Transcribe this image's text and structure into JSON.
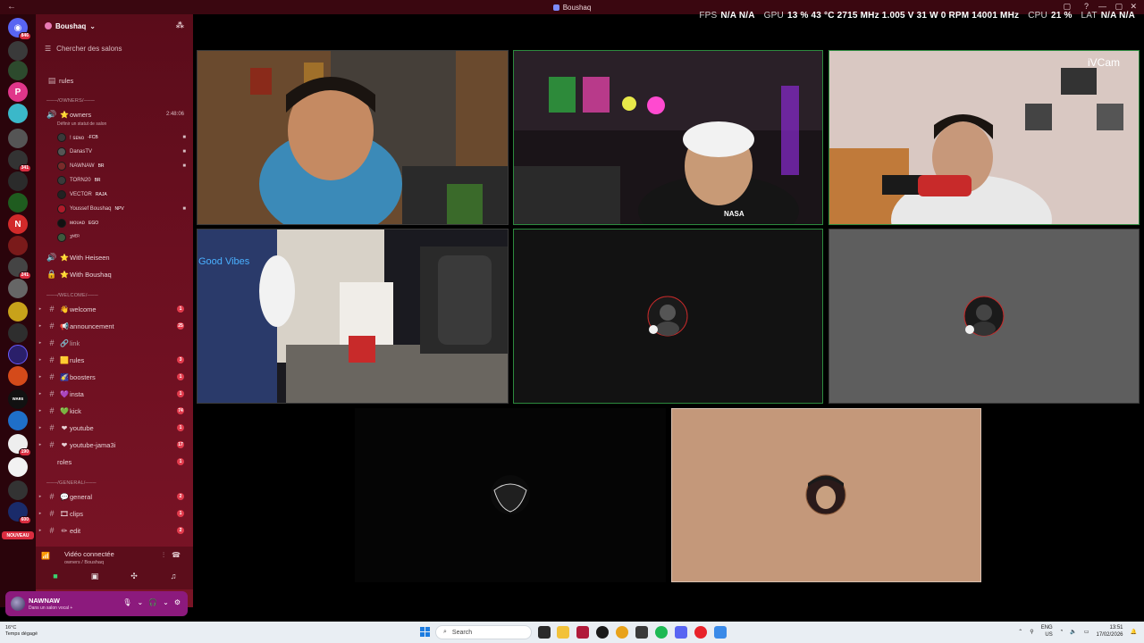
{
  "titlebar": {
    "title": "Boushaq"
  },
  "perf": [
    {
      "key": "FPS",
      "value": "N/A  N/A"
    },
    {
      "key": "GPU",
      "value": "13 %  43 °C  2715 MHz  1.005 V  31 W  0 RPM  14001 MHz"
    },
    {
      "key": "CPU",
      "value": "21 %"
    },
    {
      "key": "LAT",
      "value": "N/A  N/A"
    }
  ],
  "server": {
    "name": "Boushaq",
    "search_placeholder": "Chercher des salons"
  },
  "rail_badges": [
    "846",
    "341",
    "241",
    "190",
    "600"
  ],
  "rail_new_label": "NOUVEAU",
  "channels_top": [
    {
      "label": "rules"
    }
  ],
  "owners_category": "───/OWNERS/───",
  "owners_channel": {
    "label": "owners",
    "timer": "2:48:06",
    "status_hint": "Définir un statut de salon"
  },
  "members": [
    {
      "name": "! ꜱᴇɴᴏ",
      "tag": "-FCB",
      "cam": true
    },
    {
      "name": "DanasTV",
      "tag": "",
      "cam": true
    },
    {
      "name": "NAWNAW",
      "tag": "BR",
      "cam": true
    },
    {
      "name": "TORN20",
      "tag": "BR",
      "cam": false
    },
    {
      "name": "VECTOR",
      "tag": "RAJA",
      "cam": false
    },
    {
      "name": "Youssef Boushaq",
      "tag": "NPV",
      "cam": true
    },
    {
      "name": "ᴍᴏᴜᴀᴅ",
      "tag": "EGO",
      "cam": false
    },
    {
      "name": "ᴣᴹᴱᴿ",
      "tag": "",
      "cam": false
    }
  ],
  "voice_channels": [
    {
      "label": "With Heiseen"
    },
    {
      "label": "With Boushaq"
    }
  ],
  "welcome_category": "───/WELCOME/───",
  "text_channels": [
    {
      "label": "welcome",
      "emoji": "👋",
      "count": "1"
    },
    {
      "label": "announcement",
      "emoji": "📢",
      "count": "25"
    },
    {
      "label": "link",
      "emoji": "🔗",
      "count": ""
    },
    {
      "label": "rules",
      "emoji": "🟨",
      "count": "3"
    },
    {
      "label": "boosters",
      "emoji": "🌠",
      "count": "1"
    },
    {
      "label": "insta",
      "emoji": "💜",
      "count": "1"
    },
    {
      "label": "kick",
      "emoji": "💚",
      "count": "74"
    },
    {
      "label": "youtube",
      "emoji": "❤",
      "count": "1"
    },
    {
      "label": "youtube-jama3i",
      "emoji": "❤",
      "count": "17"
    },
    {
      "label": "roles",
      "emoji": "",
      "count": "1"
    }
  ],
  "general_category": "───/GENERAL/───",
  "general_channels": [
    {
      "label": "general",
      "emoji": "💬",
      "count": "2"
    },
    {
      "label": "clips",
      "emoji": "🎞",
      "count": "1"
    },
    {
      "label": "edit",
      "emoji": "✏",
      "count": "2"
    }
  ],
  "voice_status": {
    "title": "Vidéo connectée",
    "subtitle": "owners / Boushaq"
  },
  "user": {
    "name": "NAWNAW",
    "status": "Dans un salon vocal +"
  },
  "tiles": [
    {
      "name": "tile-1",
      "kind": "video"
    },
    {
      "name": "tile-2",
      "kind": "video",
      "watermark": "NASA"
    },
    {
      "name": "tile-3",
      "kind": "video",
      "watermark": "iVCam"
    },
    {
      "name": "tile-4",
      "kind": "video",
      "neon": "Good Vibes"
    },
    {
      "name": "tile-5",
      "kind": "avatar"
    },
    {
      "name": "tile-6",
      "kind": "avatar"
    },
    {
      "name": "tile-7",
      "kind": "avatar"
    },
    {
      "name": "tile-8",
      "kind": "avatar"
    }
  ],
  "taskbar": {
    "weather_temp": "16°C",
    "weather_desc": "Temps dégagé",
    "search_placeholder": "Search",
    "lang_top": "ENG",
    "lang_bottom": "US",
    "time": "13:51",
    "date": "17/02/2026"
  },
  "colors": {
    "sidebar_bg": "#6b0f20",
    "rail_bg": "#2a040b",
    "active_border": "#2c8a3e",
    "user_panel": "#8c1a7d",
    "badge": "#da2d40"
  }
}
